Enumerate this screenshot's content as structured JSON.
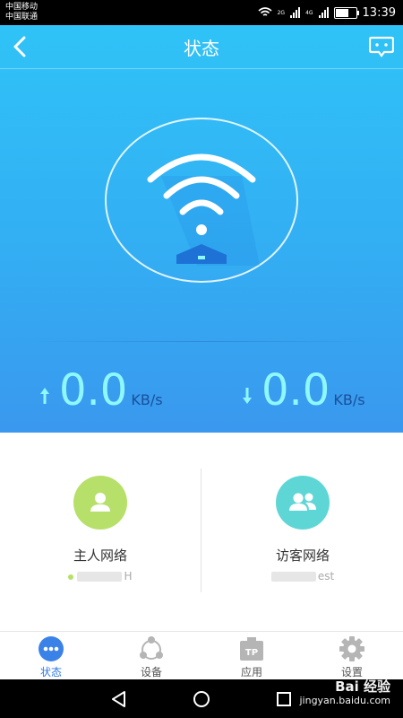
{
  "status_bar": {
    "carrier_1": "中国移动",
    "carrier_2": "中国联通",
    "network_tag_1": "2G",
    "network_tag_2": "4G",
    "time": "13:39"
  },
  "header": {
    "title": "状态"
  },
  "speeds": {
    "upload": {
      "value": "0.0",
      "unit": "KB/s"
    },
    "download": {
      "value": "0.0",
      "unit": "KB/s"
    }
  },
  "networks": {
    "host": {
      "label": "主人网络",
      "ssid_visible": "H"
    },
    "guest": {
      "label": "访客网络",
      "ssid_visible": "est"
    }
  },
  "tabs": [
    {
      "label": "状态",
      "icon": "dots-icon",
      "active": true
    },
    {
      "label": "设备",
      "icon": "devices-icon",
      "active": false
    },
    {
      "label": "应用",
      "icon": "tp-app-icon",
      "active": false
    },
    {
      "label": "设置",
      "icon": "gear-icon",
      "active": false
    }
  ],
  "watermark": {
    "line1": "Bai 经验",
    "line2": "jingyan.baidu.com"
  },
  "colors": {
    "accent": "#2f7ae0",
    "hero_top": "#2fc3f7",
    "hero_bottom": "#3a98ee",
    "speed": "#8ff8ff",
    "host": "#b6e06a",
    "guest": "#5fd6d6"
  }
}
